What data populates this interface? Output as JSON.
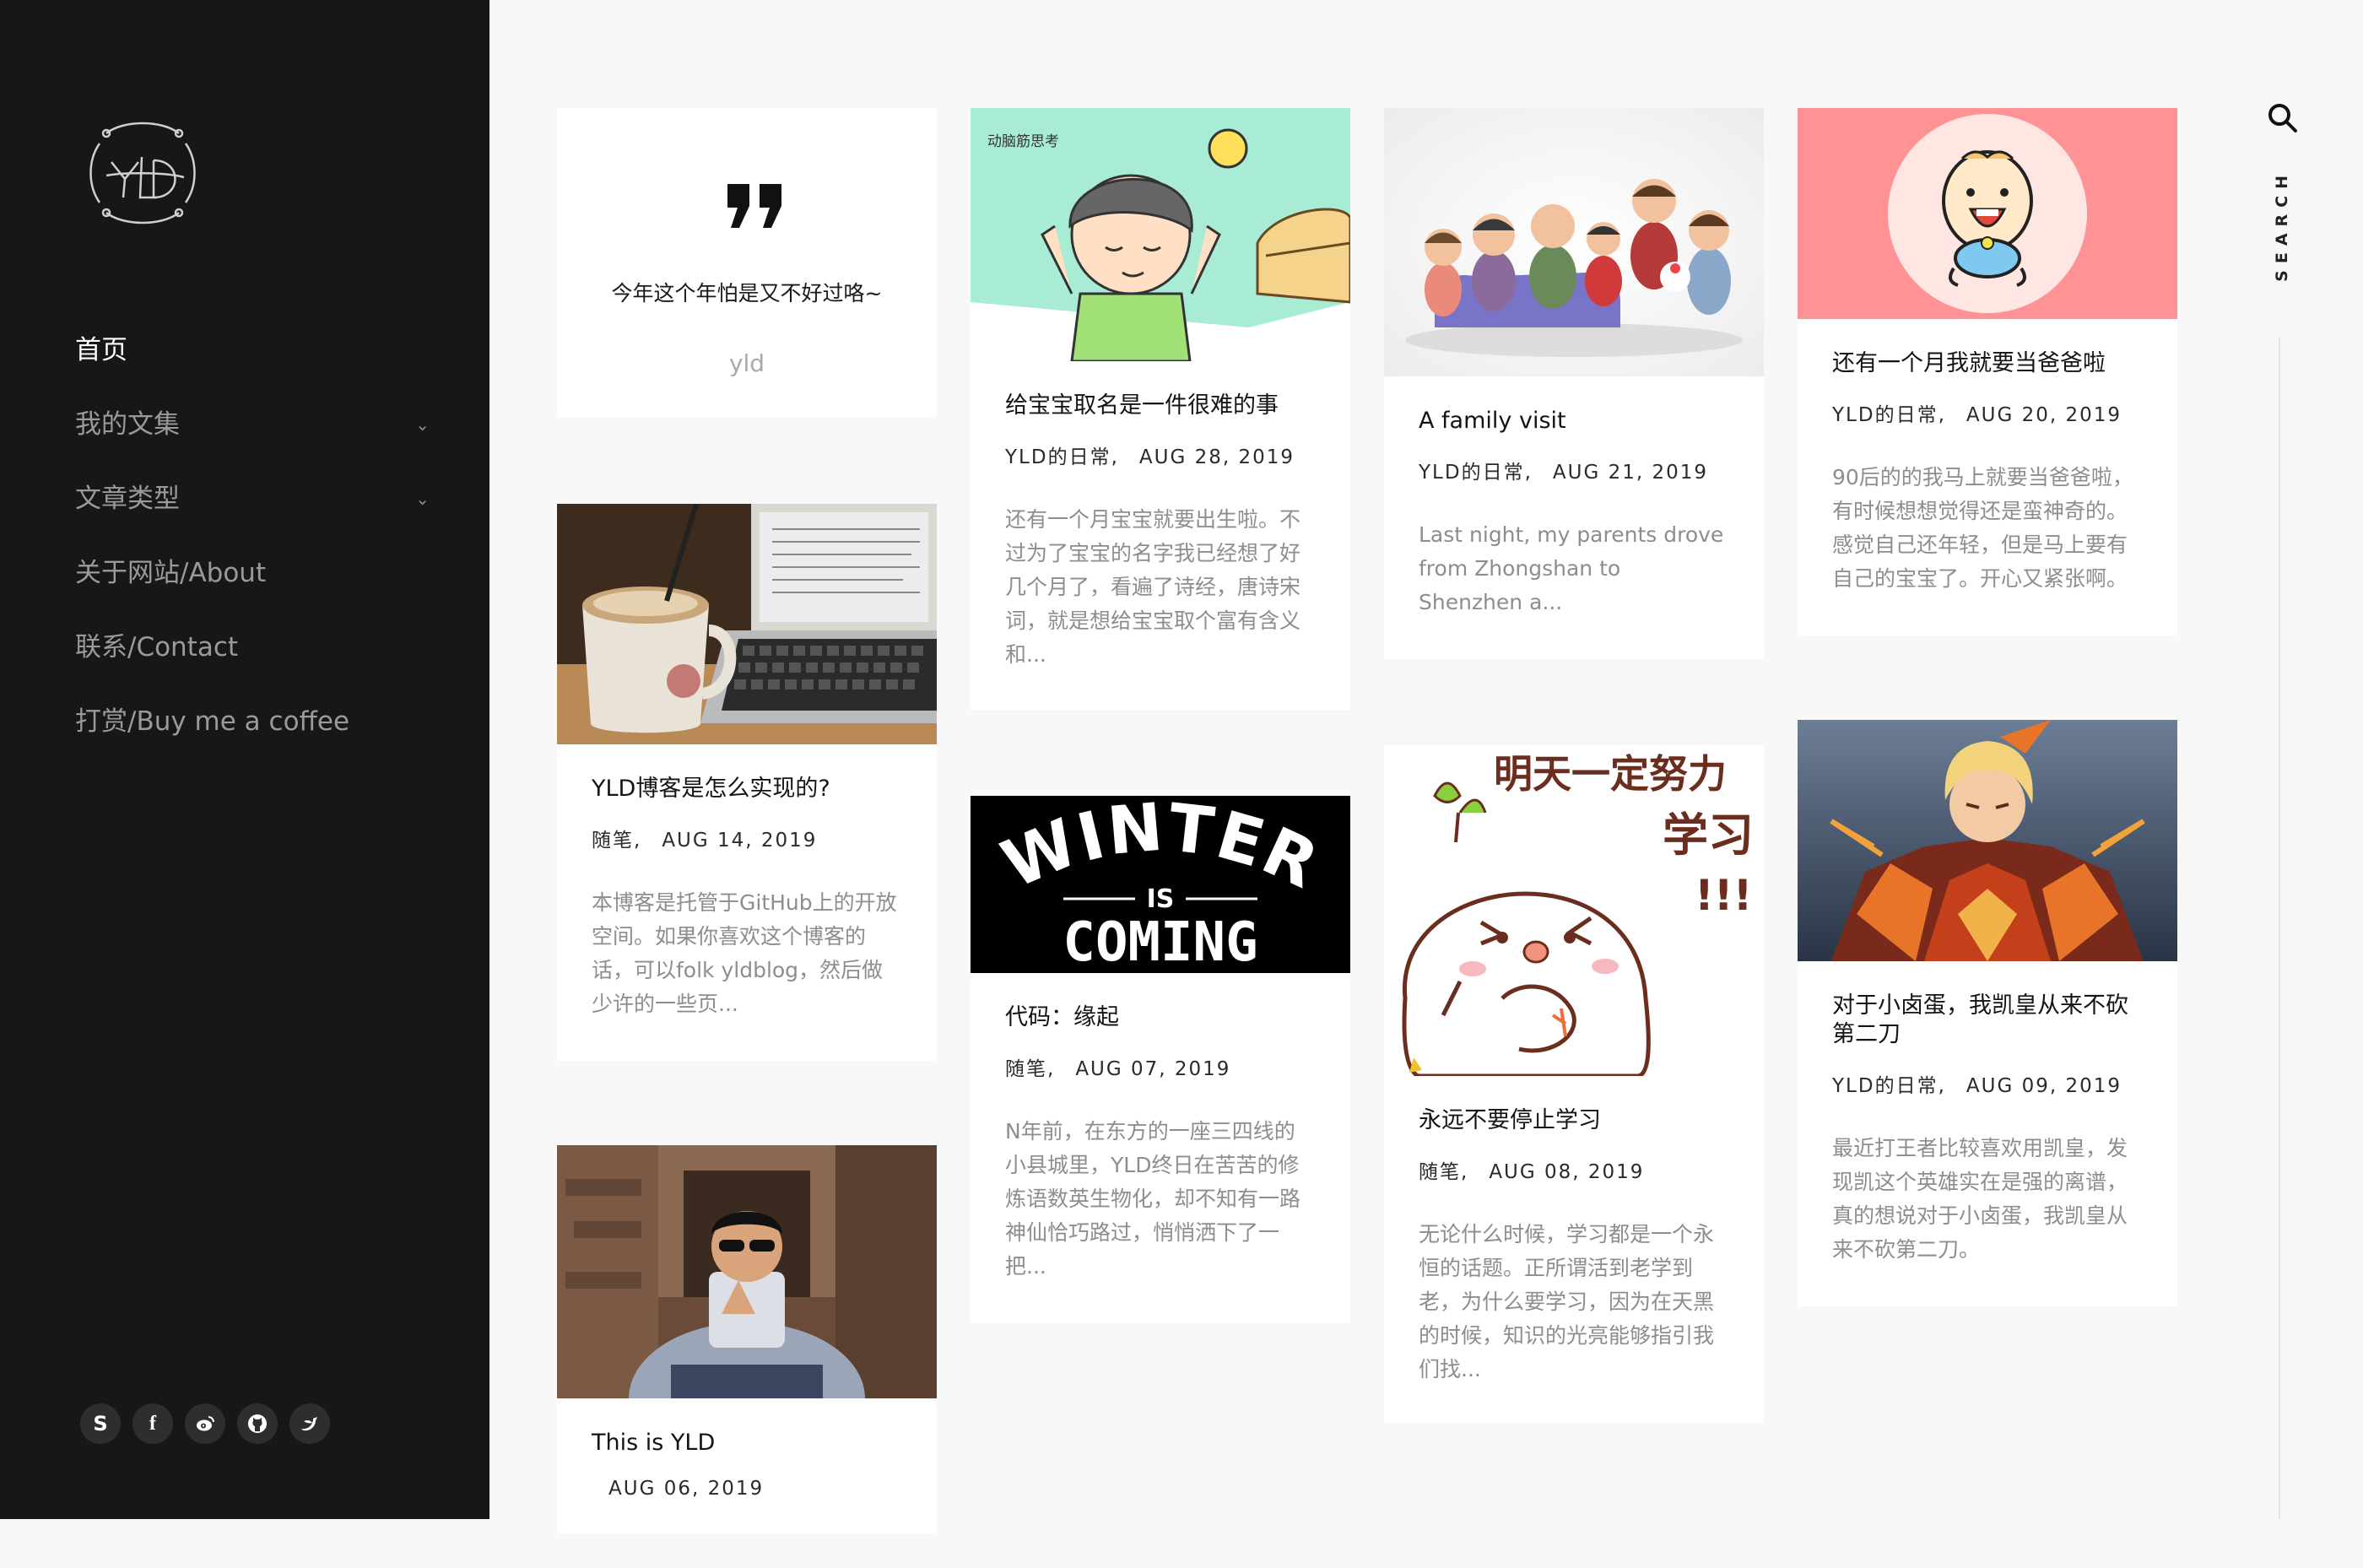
{
  "sidebar": {
    "nav": [
      {
        "label": "首页",
        "active": true
      },
      {
        "label": "我的文集",
        "has_submenu": true
      },
      {
        "label": "文章类型",
        "has_submenu": true
      },
      {
        "label": "关于网站/About"
      },
      {
        "label": "联系/Contact"
      },
      {
        "label": "打赏/Buy me a coffee"
      }
    ],
    "social": [
      {
        "icon": "s-icon",
        "glyph": "S"
      },
      {
        "icon": "facebook-icon",
        "glyph": "f"
      },
      {
        "icon": "weibo-icon"
      },
      {
        "icon": "github-icon"
      },
      {
        "icon": "twitter-icon"
      }
    ]
  },
  "search": {
    "label": "SEARCH"
  },
  "quote": {
    "text": "今年这个年怕是又不好过咯~",
    "author": "yld"
  },
  "posts": [
    {
      "title": "YLD博客是怎么实现的?",
      "category": "随笔,",
      "date": "AUG 14, 2019",
      "excerpt": "本博客是托管于GitHub上的开放空间。如果你喜欢这个博客的话，可以folk yldblog，然后做少许的一些页..."
    },
    {
      "title": "This is YLD",
      "category": "",
      "date": "AUG 06, 2019",
      "excerpt": ""
    },
    {
      "title": "给宝宝取名是一件很难的事",
      "category": "YLD的日常,",
      "date": "AUG 28, 2019",
      "excerpt": "还有一个月宝宝就要出生啦。不过为了宝宝的名字我已经想了好几个月了，看遍了诗经，唐诗宋词，就是想给宝宝取个富有含义和...",
      "image_caption": "动脑筋思考"
    },
    {
      "title": "代码：缘起",
      "category": "随笔,",
      "date": "AUG 07, 2019",
      "excerpt": "N年前，在东方的一座三四线的小县城里，YLD终日在苦苦的修炼语数英生物化，却不知有一路神仙恰巧路过，悄悄洒下了一把...",
      "image_text": {
        "top": "WINTER",
        "middle": "IS",
        "bottom": "COMING"
      }
    },
    {
      "title": "A family visit",
      "category": "YLD的日常,",
      "date": "AUG 21, 2019",
      "excerpt": "Last night, my parents drove from Zhongshan to Shenzhen a..."
    },
    {
      "title": "永远不要停止学习",
      "category": "随笔,",
      "date": "AUG 08, 2019",
      "excerpt": "无论什么时候，学习都是一个永恒的话题。正所谓活到老学到老，为什么要学习，因为在天黑的时候，知识的光亮能够指引我们找...",
      "image_text": {
        "line1": "明天一定努力",
        "line2": "学习",
        "line3": "!!!"
      }
    },
    {
      "title": "还有一个月我就要当爸爸啦",
      "category": "YLD的日常,",
      "date": "AUG 20, 2019",
      "excerpt": "90后的的我马上就要当爸爸啦，有时候想想觉得还是蛮神奇的。感觉自己还年轻，但是马上要有自己的宝宝了。开心又紧张啊。"
    },
    {
      "title": "对于小卤蛋，我凯皇从来不砍第二刀",
      "category": "YLD的日常,",
      "date": "AUG 09, 2019",
      "excerpt": "最近打王者比较喜欢用凯皇，发现凯这个英雄实在是强的离谱，真的想说对于小卤蛋，我凯皇从来不砍第二刀。"
    }
  ]
}
